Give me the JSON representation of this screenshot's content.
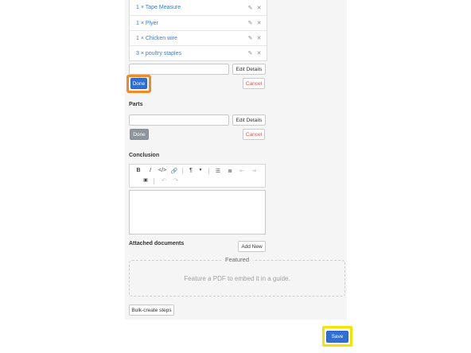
{
  "tools": [
    {
      "label": "1 × Tape Measure"
    },
    {
      "label": "1 × Plyer"
    },
    {
      "label": "1 × Chicken wire"
    },
    {
      "label": "3 × poultry staples"
    }
  ],
  "tools_section": {
    "edit_details_label": "Edit Details",
    "done_label": "Done",
    "cancel_label": "Cancel"
  },
  "parts_section": {
    "title": "Parts",
    "edit_details_label": "Edit Details",
    "done_label": "Done",
    "cancel_label": "Cancel"
  },
  "conclusion": {
    "title": "Conclusion"
  },
  "attached": {
    "title": "Attached documents",
    "add_new_label": "Add New"
  },
  "featured": {
    "title": "Featured",
    "hint": "Feature a PDF to embed it in a guide."
  },
  "bulk_create_label": "Bulk-create steps",
  "save_label": "Save",
  "icons": {
    "edit": "pencil-icon",
    "delete": "close-icon"
  },
  "colors": {
    "link": "#3a7bd5",
    "primary": "#2f6fd6",
    "cancel": "#d9534f",
    "highlight_orange": "#f08a24",
    "highlight_yellow": "#f4e400"
  }
}
